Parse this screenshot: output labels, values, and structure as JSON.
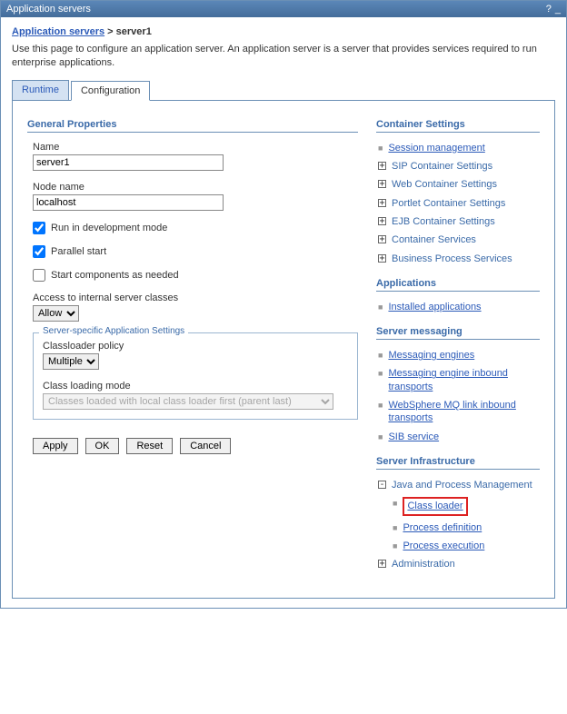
{
  "title": "Application servers",
  "breadcrumb": {
    "link": "Application servers",
    "sep": ">",
    "current": "server1"
  },
  "desc": "Use this page to configure an application server. An application server is a server that provides services required to run enterprise applications.",
  "tabs": {
    "runtime": "Runtime",
    "configuration": "Configuration"
  },
  "general": {
    "heading": "General Properties",
    "name_label": "Name",
    "name_value": "server1",
    "node_label": "Node name",
    "node_value": "localhost",
    "dev_mode": "Run in development mode",
    "parallel": "Parallel start",
    "start_comp": "Start components as needed",
    "access_label": "Access to internal server classes",
    "access_value": "Allow"
  },
  "server_specific": {
    "heading": "Server-specific Application Settings",
    "cl_policy_label": "Classloader policy",
    "cl_policy_value": "Multiple",
    "cl_mode_label": "Class loading mode",
    "cl_mode_value": "Classes loaded with local class loader first (parent last)"
  },
  "buttons": {
    "apply": "Apply",
    "ok": "OK",
    "reset": "Reset",
    "cancel": "Cancel"
  },
  "right": {
    "container": {
      "heading": "Container Settings",
      "session": "Session management",
      "sip": "SIP Container Settings",
      "web": "Web Container Settings",
      "portlet": "Portlet Container Settings",
      "ejb": "EJB Container Settings",
      "services": "Container Services",
      "bp": "Business Process Services"
    },
    "apps": {
      "heading": "Applications",
      "installed": "Installed applications"
    },
    "msg": {
      "heading": "Server messaging",
      "engines": "Messaging engines",
      "inbound": "Messaging engine inbound transports",
      "mq": "WebSphere MQ link inbound transports",
      "sib": "SIB service"
    },
    "infra": {
      "heading": "Server Infrastructure",
      "java": "Java and Process Management",
      "classloader": "Class loader",
      "procdef": "Process definition",
      "procexec": "Process execution",
      "admin": "Administration"
    }
  }
}
